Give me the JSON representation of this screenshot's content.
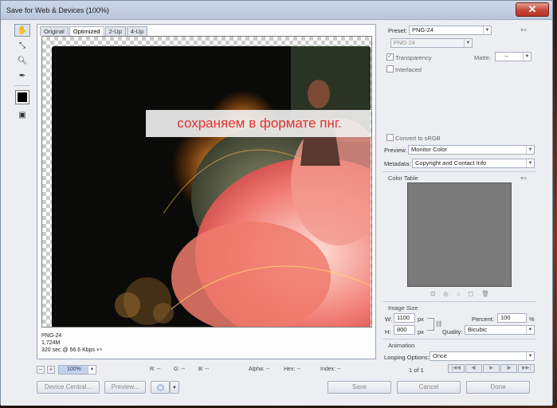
{
  "window": {
    "title": "Save for Web & Devices (100%)",
    "close_glyph": "✕"
  },
  "tabs": [
    {
      "label": "Original"
    },
    {
      "label": "Optimized"
    },
    {
      "label": "2-Up"
    },
    {
      "label": "4-Up"
    }
  ],
  "overlay_caption": "сохраняем в формате пнг.",
  "image_info": {
    "format": "PNG-24",
    "size": "1,724M",
    "time": "320 sec @ 56.6 Kbps",
    "menu_glyph": "▾≡"
  },
  "settings": {
    "preset_label": "Preset:",
    "preset_value": "PNG-24",
    "format_value": "PNG-24",
    "transparency_label": "Transparency",
    "transparency_checked": true,
    "matte_label": "Matte:",
    "matte_value": "--",
    "interlaced_label": "Interlaced",
    "interlaced_checked": false,
    "convert_srgb_label": "Convert to sRGB",
    "preview_label": "Preview:",
    "preview_value": "Monitor Color",
    "metadata_label": "Metadata:",
    "metadata_value": "Copyright and Contact Info",
    "color_table_label": "Color Table",
    "color_table_fill": "#7a7a7a"
  },
  "image_size": {
    "title": "Image Size",
    "w_label": "W:",
    "w_value": "1100",
    "h_label": "H:",
    "h_value": "800",
    "unit": "px",
    "percent_label": "Percent:",
    "percent_value": "100",
    "percent_unit": "%",
    "quality_label": "Quality:",
    "quality_value": "Bicubic"
  },
  "animation": {
    "title": "Animation",
    "looping_label": "Looping Options:",
    "looping_value": "Once",
    "frame_counter": "1 of 1"
  },
  "status_bar": {
    "zoom_value": "100%",
    "r": "R: --",
    "g": "G: --",
    "b": "B: --",
    "alpha": "Alpha: --",
    "hex": "Hex: --",
    "index": "Index: --"
  },
  "buttons": {
    "device_central": "Device Central...",
    "preview": "Preview...",
    "save": "Save",
    "cancel": "Cancel",
    "done": "Done"
  },
  "colors": {
    "caption_text": "#e0332e",
    "close_button": "#c5483a",
    "zoom_highlight": "#c4d3ec"
  }
}
